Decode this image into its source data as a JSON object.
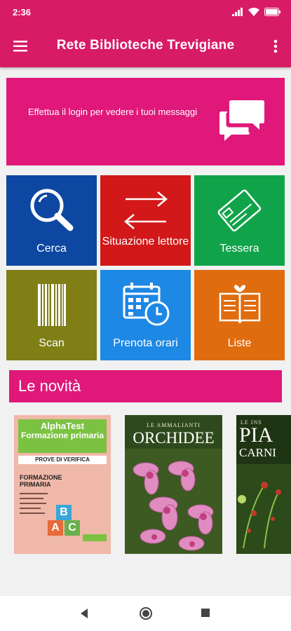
{
  "status": {
    "time": "2:36"
  },
  "appbar": {
    "title": "Rete Biblioteche Trevigiane"
  },
  "login": {
    "message": "Effettua il login per vedere i tuoi messaggi"
  },
  "tiles": [
    {
      "label": "Cerca",
      "color": "#0d47a1",
      "icon": "search-icon"
    },
    {
      "label": "Situazione lettore",
      "color": "#d21818",
      "icon": "swap-arrows-icon"
    },
    {
      "label": "Tessera",
      "color": "#11a34a",
      "icon": "card-icon"
    },
    {
      "label": "Scan",
      "color": "#7f7f16",
      "icon": "barcode-icon"
    },
    {
      "label": "Prenota orari",
      "color": "#1e88e5",
      "icon": "calendar-clock-icon"
    },
    {
      "label": "Liste",
      "color": "#e06c10",
      "icon": "open-book-icon"
    }
  ],
  "news": {
    "title": "Le novità"
  },
  "books": [
    {
      "top_brand": "AlphaTest",
      "top_title": "Formazione primaria",
      "subtitle": "PROVE DI VERIFICA",
      "main_title": "FORMAZIONE PRIMARIA",
      "blocks": [
        "A",
        "B",
        "C"
      ]
    },
    {
      "series": "LE AMMALIANTI",
      "title": "ORCHIDEE"
    },
    {
      "series": "LE INS",
      "title": "PIA",
      "title2": "CARNI"
    }
  ],
  "colors": {
    "primary": "#d81b66",
    "accent": "#e0187a"
  }
}
